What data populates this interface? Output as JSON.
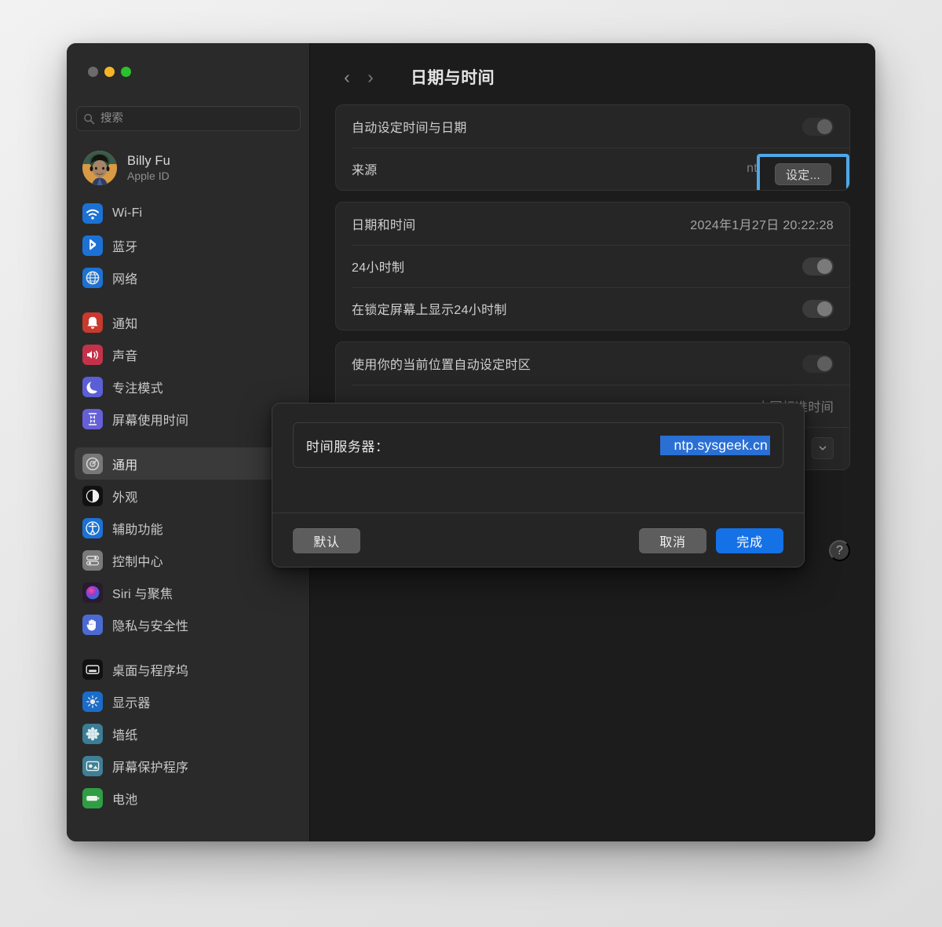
{
  "window": {
    "traffic_lights": [
      "close",
      "minimize",
      "maximize"
    ]
  },
  "sidebar": {
    "search": {
      "placeholder": "搜索",
      "value": "",
      "icon": "search-icon"
    },
    "account": {
      "name": "Billy Fu",
      "subtitle": "Apple ID",
      "avatar": "memoji-avatar"
    },
    "groups": [
      {
        "items": [
          {
            "label": "Wi-Fi",
            "icon": "wifi-icon",
            "selected": false
          },
          {
            "label": "蓝牙",
            "icon": "bluetooth-icon",
            "selected": false
          },
          {
            "label": "网络",
            "icon": "network-globe-icon",
            "selected": false
          }
        ]
      },
      {
        "items": [
          {
            "label": "通知",
            "icon": "notifications-bell-icon",
            "selected": false
          },
          {
            "label": "声音",
            "icon": "sound-speaker-icon",
            "selected": false
          },
          {
            "label": "专注模式",
            "icon": "focus-moon-icon",
            "selected": false
          },
          {
            "label": "屏幕使用时间",
            "icon": "screen-time-hourglass-icon",
            "selected": false
          }
        ]
      },
      {
        "items": [
          {
            "label": "通用",
            "icon": "general-gear-icon",
            "selected": true
          },
          {
            "label": "外观",
            "icon": "appearance-contrast-icon",
            "selected": false
          },
          {
            "label": "辅助功能",
            "icon": "accessibility-icon",
            "selected": false
          },
          {
            "label": "控制中心",
            "icon": "control-center-icon",
            "selected": false
          },
          {
            "label": "Siri 与聚焦",
            "icon": "siri-icon",
            "selected": false
          },
          {
            "label": "隐私与安全性",
            "icon": "privacy-hand-icon",
            "selected": false
          }
        ]
      },
      {
        "items": [
          {
            "label": "桌面与程序坞",
            "icon": "desktop-dock-icon",
            "selected": false
          },
          {
            "label": "显示器",
            "icon": "displays-brightness-icon",
            "selected": false
          },
          {
            "label": "墙纸",
            "icon": "wallpaper-icon",
            "selected": false
          },
          {
            "label": "屏幕保护程序",
            "icon": "screensaver-icon",
            "selected": false
          },
          {
            "label": "电池",
            "icon": "battery-icon",
            "selected": false
          }
        ]
      }
    ]
  },
  "main": {
    "back_icon": "chevron-left-icon",
    "forward_icon": "chevron-right-icon",
    "title": "日期与时间",
    "panel_one": {
      "auto_set": {
        "label": "自动设定时间与日期",
        "toggle_state": "on-disabled"
      },
      "source": {
        "label": "来源",
        "value": "ntp.sysgeek.cn",
        "button_label": "设定...",
        "highlight_color": "#4fa8e8"
      }
    },
    "panel_two": {
      "date_time": {
        "label": "日期和时间",
        "value": "2024年1月27日 20:22:28"
      },
      "twenty_four_hour": {
        "label": "24小时制",
        "toggle_state": "on"
      },
      "lock_screen_24h": {
        "label": "在锁定屏幕上显示24小时制",
        "toggle_state": "on"
      }
    },
    "panel_three": {
      "auto_timezone": {
        "label": "使用你的当前位置自动设定时区",
        "toggle_state": "on-disabled"
      },
      "timezone": {
        "value": "中国标准时间",
        "chevron_icon": "chevron-down-icon"
      }
    },
    "help_button": {
      "label": "?",
      "icon": "help-question-icon"
    }
  },
  "modal": {
    "field": {
      "label": "时间服务器：",
      "value": "ntp.sysgeek.cn",
      "selected": true
    },
    "buttons": {
      "default_label": "默认",
      "cancel_label": "取消",
      "done_label": "完成"
    },
    "accent_color": "#1571e6",
    "selection_color": "#2a6fd4"
  }
}
